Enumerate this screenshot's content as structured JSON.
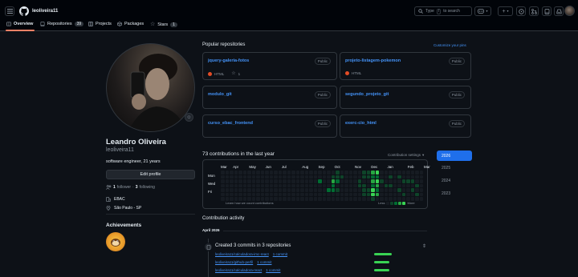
{
  "header": {
    "username": "leoliveira11",
    "search_prefix": "Type",
    "search_key": "/",
    "search_suffix": "to search"
  },
  "tabs": [
    {
      "label": "Overview"
    },
    {
      "label": "Repositories",
      "count": "39"
    },
    {
      "label": "Projects"
    },
    {
      "label": "Packages"
    },
    {
      "label": "Stars",
      "count": "1"
    }
  ],
  "profile": {
    "name": "Leandro Oliveira",
    "login": "leoliveira11",
    "bio": "software engineer, 21 years",
    "edit_label": "Edit profile",
    "followers_count": "1",
    "followers_label": "follower",
    "following_count": "3",
    "following_label": "following",
    "company": "EBAC",
    "location": "São Paulo - SP",
    "achievements_title": "Achievements"
  },
  "popular": {
    "title": "Popular repositories",
    "customize": "Customize your pins",
    "repos": [
      {
        "name": "jquery-galeria-fotos",
        "visibility": "Public",
        "language": "HTML",
        "lang_color": "#e34c26",
        "stars": "1"
      },
      {
        "name": "projeto-listagem-pokemon",
        "visibility": "Public",
        "language": "HTML",
        "lang_color": "#e34c26"
      },
      {
        "name": "modulo_git",
        "visibility": "Public"
      },
      {
        "name": "segundo_projeto_git",
        "visibility": "Public"
      },
      {
        "name": "curso_ebac_frontend",
        "visibility": "Public"
      },
      {
        "name": "exerc-cio_html",
        "visibility": "Public"
      }
    ]
  },
  "contributions": {
    "summary": "73 contributions in the last year",
    "settings": "Contribution settings",
    "months": [
      "Mar",
      "Apr",
      "May",
      "Jun",
      "Jul",
      "Aug",
      "Sep",
      "Oct",
      "Nov",
      "Dec",
      "Jan",
      "Feb",
      "Mar"
    ],
    "days": [
      "Mon",
      "Wed",
      "Fri"
    ],
    "learn": "Learn how we count contributions",
    "less": "Less",
    "more": "More",
    "levels": [
      "#161b22",
      "#0e4429",
      "#006d32",
      "#26a641",
      "#39d353"
    ],
    "active": [
      [
        22,
        2,
        2
      ],
      [
        24,
        4,
        2
      ],
      [
        25,
        1,
        1
      ],
      [
        25,
        2,
        3
      ],
      [
        25,
        3,
        2
      ],
      [
        25,
        4,
        2
      ],
      [
        26,
        0,
        1
      ],
      [
        26,
        1,
        1
      ],
      [
        26,
        2,
        2
      ],
      [
        26,
        4,
        1
      ],
      [
        27,
        1,
        1
      ],
      [
        31,
        2,
        1
      ],
      [
        31,
        3,
        1
      ],
      [
        32,
        0,
        1
      ],
      [
        32,
        1,
        1
      ],
      [
        32,
        3,
        1
      ],
      [
        32,
        4,
        1
      ],
      [
        32,
        5,
        1
      ],
      [
        33,
        0,
        1
      ],
      [
        33,
        1,
        1
      ],
      [
        33,
        4,
        1
      ],
      [
        33,
        5,
        1
      ],
      [
        34,
        0,
        3
      ],
      [
        34,
        1,
        2
      ],
      [
        34,
        2,
        3
      ],
      [
        34,
        3,
        2
      ],
      [
        34,
        4,
        4
      ],
      [
        34,
        5,
        4
      ],
      [
        34,
        6,
        1
      ],
      [
        35,
        0,
        4
      ],
      [
        35,
        1,
        2
      ],
      [
        35,
        2,
        4
      ],
      [
        35,
        3,
        3
      ],
      [
        35,
        4,
        2
      ],
      [
        35,
        5,
        3
      ],
      [
        36,
        2,
        1
      ],
      [
        37,
        3,
        1
      ],
      [
        38,
        1,
        1
      ],
      [
        38,
        3,
        1
      ],
      [
        40,
        1,
        1
      ],
      [
        40,
        4,
        1
      ],
      [
        41,
        2,
        1
      ],
      [
        41,
        5,
        1
      ],
      [
        42,
        2,
        1
      ],
      [
        43,
        2,
        1
      ],
      [
        43,
        4,
        1
      ],
      [
        44,
        3,
        1
      ],
      [
        44,
        5,
        1
      ]
    ]
  },
  "years": [
    "2026",
    "2025",
    "2024",
    "2023"
  ],
  "activity": {
    "title": "Contribution activity",
    "month": "April 2026",
    "headline": "Created 3 commits in 3 repositories",
    "items": [
      {
        "repo": "leoliveira11/calculadora-imc-react",
        "commits": "1 commit",
        "bar": 0.9
      },
      {
        "repo": "leoliveira11/github-perfil",
        "commits": "1 commit",
        "bar": 0.8
      },
      {
        "repo": "leoliveira11/calculadora-react",
        "commits": "1 commit",
        "bar": 0.8
      }
    ]
  }
}
